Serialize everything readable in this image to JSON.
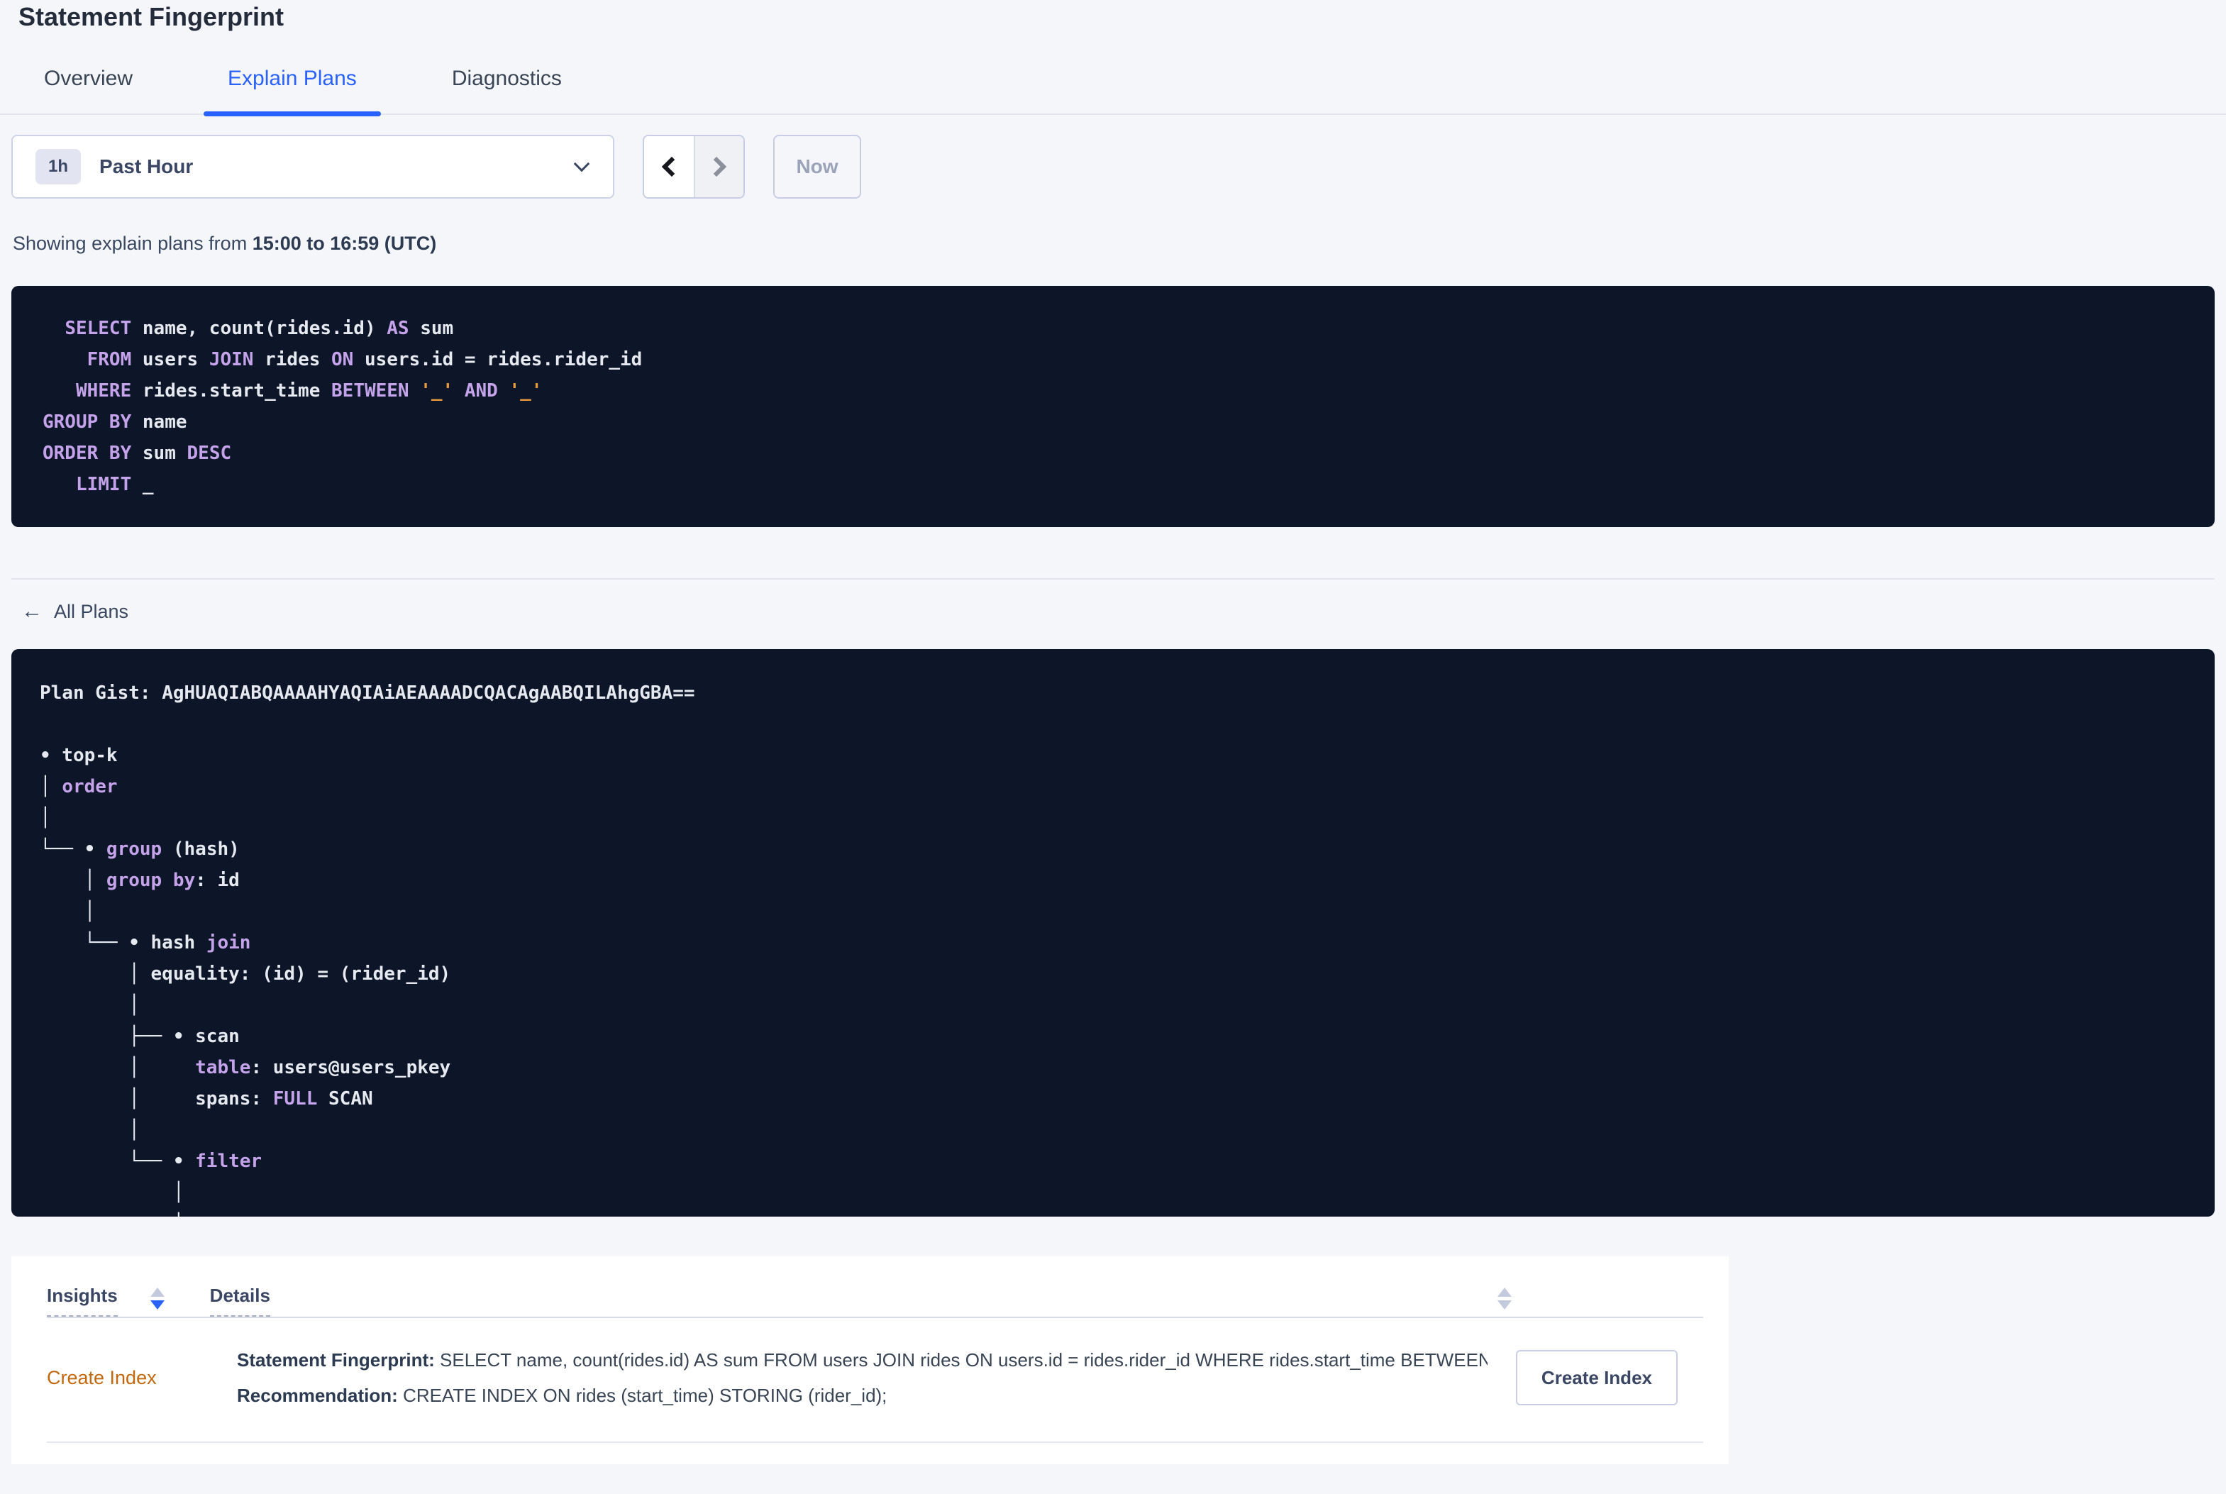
{
  "page": {
    "title": "Statement Fingerprint"
  },
  "tabs": [
    {
      "label": "Overview",
      "active": false
    },
    {
      "label": "Explain Plans",
      "active": true
    },
    {
      "label": "Diagnostics",
      "active": false
    }
  ],
  "time_picker": {
    "badge": "1h",
    "selected": "Past Hour",
    "now_label": "Now"
  },
  "showing": {
    "prefix": "Showing explain plans from ",
    "range": "15:00 to 16:59 (UTC)"
  },
  "sql_block": {
    "lines": [
      [
        {
          "t": "  ",
          "c": "p"
        },
        {
          "t": "SELECT",
          "c": "k"
        },
        {
          "t": " name, count(rides.id) ",
          "c": "p"
        },
        {
          "t": "AS",
          "c": "k"
        },
        {
          "t": " sum",
          "c": "p"
        }
      ],
      [
        {
          "t": "    ",
          "c": "p"
        },
        {
          "t": "FROM",
          "c": "k"
        },
        {
          "t": " users ",
          "c": "p"
        },
        {
          "t": "JOIN",
          "c": "k"
        },
        {
          "t": " rides ",
          "c": "p"
        },
        {
          "t": "ON",
          "c": "k"
        },
        {
          "t": " users.id = rides.rider_id",
          "c": "p"
        }
      ],
      [
        {
          "t": "   ",
          "c": "p"
        },
        {
          "t": "WHERE",
          "c": "k"
        },
        {
          "t": " rides.start_time ",
          "c": "p"
        },
        {
          "t": "BETWEEN",
          "c": "k"
        },
        {
          "t": " ",
          "c": "p"
        },
        {
          "t": "'_'",
          "c": "l"
        },
        {
          "t": " ",
          "c": "p"
        },
        {
          "t": "AND",
          "c": "k"
        },
        {
          "t": " ",
          "c": "p"
        },
        {
          "t": "'_'",
          "c": "l"
        }
      ],
      [
        {
          "t": "GROUP BY",
          "c": "k"
        },
        {
          "t": " name",
          "c": "p"
        }
      ],
      [
        {
          "t": "ORDER BY",
          "c": "k"
        },
        {
          "t": " sum ",
          "c": "p"
        },
        {
          "t": "DESC",
          "c": "k"
        }
      ],
      [
        {
          "t": "   ",
          "c": "p"
        },
        {
          "t": "LIMIT",
          "c": "k"
        },
        {
          "t": " _",
          "c": "p"
        }
      ]
    ]
  },
  "all_plans": {
    "label": "All Plans"
  },
  "plan_panel": {
    "gist_label": "Plan Gist: ",
    "gist": "AgHUAQIABQAAAAHYAQIAiAEAAAADCQACAgAABQILAhgGBA==",
    "tree": [
      [
        {
          "t": "• top-k",
          "c": "p"
        }
      ],
      [
        {
          "t": "│ ",
          "c": "p"
        },
        {
          "t": "order",
          "c": "k"
        }
      ],
      [
        {
          "t": "│",
          "c": "p"
        }
      ],
      [
        {
          "t": "└── • ",
          "c": "p"
        },
        {
          "t": "group",
          "c": "k"
        },
        {
          "t": " (hash)",
          "c": "p"
        }
      ],
      [
        {
          "t": "    │ ",
          "c": "p"
        },
        {
          "t": "group by",
          "c": "k"
        },
        {
          "t": ": id",
          "c": "p"
        }
      ],
      [
        {
          "t": "    │",
          "c": "p"
        }
      ],
      [
        {
          "t": "    └── • hash ",
          "c": "p"
        },
        {
          "t": "join",
          "c": "k"
        }
      ],
      [
        {
          "t": "        │ equality: (id) = (rider_id)",
          "c": "p"
        }
      ],
      [
        {
          "t": "        │",
          "c": "p"
        }
      ],
      [
        {
          "t": "        ├── • scan",
          "c": "p"
        }
      ],
      [
        {
          "t": "        │     ",
          "c": "p"
        },
        {
          "t": "table",
          "c": "k"
        },
        {
          "t": ": users@users_pkey",
          "c": "p"
        }
      ],
      [
        {
          "t": "        │     spans: ",
          "c": "p"
        },
        {
          "t": "FULL",
          "c": "k"
        },
        {
          "t": " SCAN",
          "c": "p"
        }
      ],
      [
        {
          "t": "        │",
          "c": "p"
        }
      ],
      [
        {
          "t": "        └── • ",
          "c": "p"
        },
        {
          "t": "filter",
          "c": "k"
        }
      ],
      [
        {
          "t": "            │",
          "c": "p"
        }
      ],
      [
        {
          "t": "            │",
          "c": "p"
        }
      ]
    ]
  },
  "insights": {
    "columns": [
      {
        "label": "Insights"
      },
      {
        "label": "Details"
      }
    ],
    "rows": [
      {
        "type": "Create Index",
        "statement_label": "Statement Fingerprint:",
        "statement": " SELECT name, count(rides.id) AS sum FROM users JOIN rides ON users.id = rides.rider_id WHERE rides.start_time BETWEEN '_…",
        "recommendation_label": "Recommendation:",
        "recommendation": " CREATE INDEX ON rides (start_time) STORING (rider_id);",
        "action_label": "Create Index"
      }
    ]
  },
  "colors": {
    "accent_blue": "#2962ff",
    "panel_bg": "#0c1628",
    "keyword_purple": "#c5a3ea",
    "literal_orange": "#e9993e",
    "insight_orange": "#c2690f",
    "page_bg": "#f5f6fa"
  }
}
